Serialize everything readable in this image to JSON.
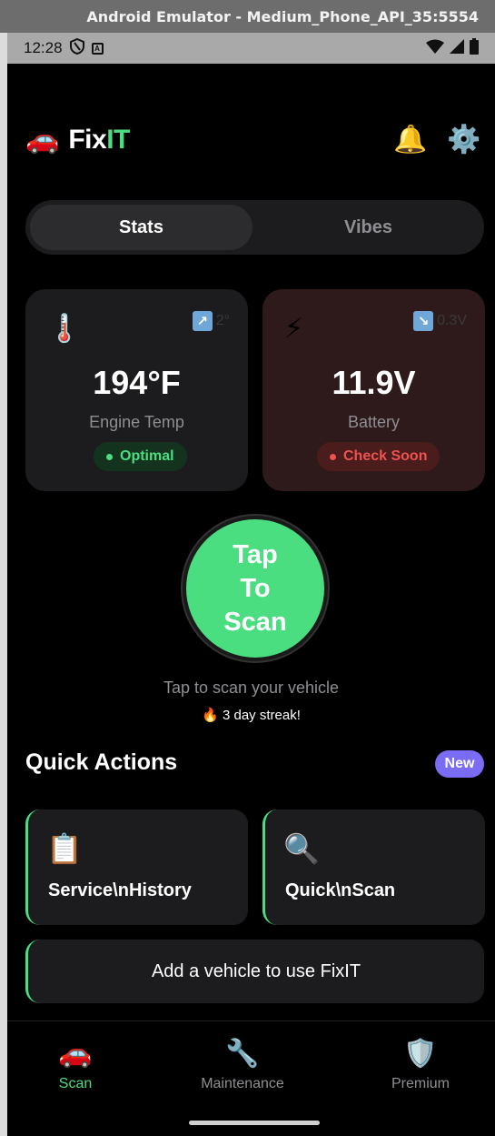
{
  "window": {
    "title": "Android Emulator - Medium_Phone_API_35:5554"
  },
  "status_bar": {
    "time": "12:28"
  },
  "header": {
    "logo_emoji": "🚗",
    "app_name_prefix": "Fix",
    "app_name_suffix": "IT",
    "bell_emoji": "🔔",
    "gear_emoji": "⚙️",
    "accent_color": "#4ade80"
  },
  "segment": {
    "tabs": [
      "Stats",
      "Vibes"
    ],
    "selected": "Stats"
  },
  "cards": {
    "engine": {
      "icon": "🌡️",
      "trend_arrow": "↗",
      "trend": "2°",
      "value": "194°F",
      "label": "Engine Temp",
      "status": "Optimal",
      "status_color": "#4ade80"
    },
    "battery": {
      "icon": "⚡",
      "trend_arrow": "↘",
      "trend": "0.3V",
      "value": "11.9V",
      "label": "Battery",
      "status": "Check Soon",
      "status_color": "#ef5350"
    }
  },
  "scan": {
    "button_label": "Tap\nTo\nScan",
    "hint": "Tap to scan your vehicle",
    "streak_icon": "🔥",
    "streak": "3 day streak!"
  },
  "quick_actions": {
    "title": "Quick Actions",
    "badge": "New",
    "items": [
      {
        "icon": "📋",
        "label": "Service\\nHistory"
      },
      {
        "icon": "🔍",
        "label": "Quick\\nScan"
      }
    ],
    "add_vehicle": "Add a vehicle to use FixIT"
  },
  "bottom_nav": {
    "items": [
      {
        "icon": "🚗",
        "label": "Scan"
      },
      {
        "icon": "🔧",
        "label": "Maintenance"
      },
      {
        "icon": "🛡️",
        "label": "Premium"
      }
    ],
    "active": "Scan"
  }
}
